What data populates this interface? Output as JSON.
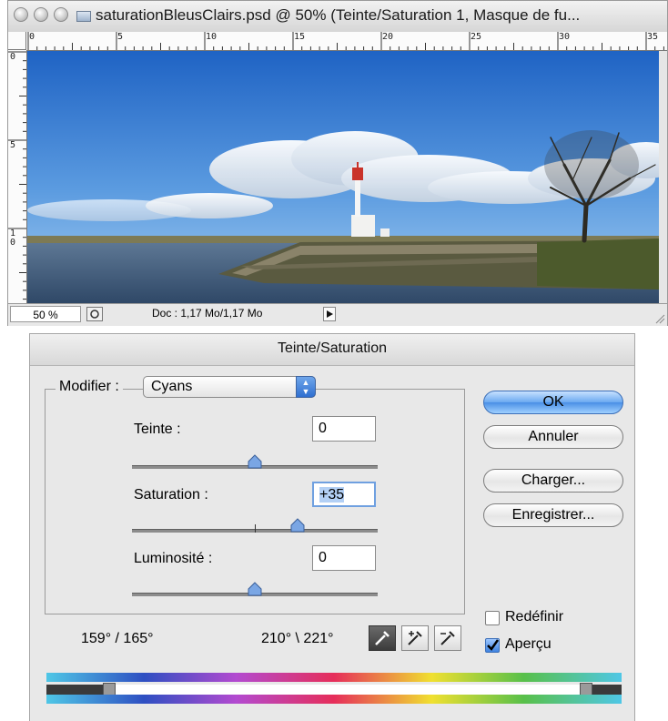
{
  "document_window": {
    "title": "saturationBleusClairs.psd @ 50% (Teinte/Saturation 1, Masque de fu...",
    "ruler_top_labels": [
      "0",
      "5",
      "10",
      "15",
      "20",
      "25",
      "30",
      "35"
    ],
    "ruler_left_labels": [
      "0",
      "5",
      "1",
      "0"
    ],
    "status": {
      "zoom": "50 %",
      "doc_info": "Doc : 1,17 Mo/1,17 Mo"
    }
  },
  "dialog": {
    "title": "Teinte/Saturation",
    "modifier_label": "Modifier :",
    "modifier_value": "Cyans",
    "hue": {
      "label": "Teinte :",
      "value": "0",
      "slider_fraction": 0.5
    },
    "saturation": {
      "label": "Saturation :",
      "value": "+35",
      "slider_fraction": 0.675
    },
    "lightness": {
      "label": "Luminosité :",
      "value": "0",
      "slider_fraction": 0.5
    },
    "buttons": {
      "ok": "OK",
      "cancel": "Annuler",
      "load": "Charger...",
      "save": "Enregistrer..."
    },
    "colorize": {
      "label": "Redéfinir",
      "checked": false
    },
    "preview": {
      "label": "Aperçu",
      "checked": true
    },
    "range_left": "159° / 165°",
    "range_right": "210° \\ 221°",
    "icons": [
      "eyedropper-icon",
      "eyedropper-plus-icon",
      "eyedropper-minus-icon"
    ],
    "colors": {
      "accent": "#4a8fe6",
      "dialog_bg": "#e8e8e8"
    }
  }
}
